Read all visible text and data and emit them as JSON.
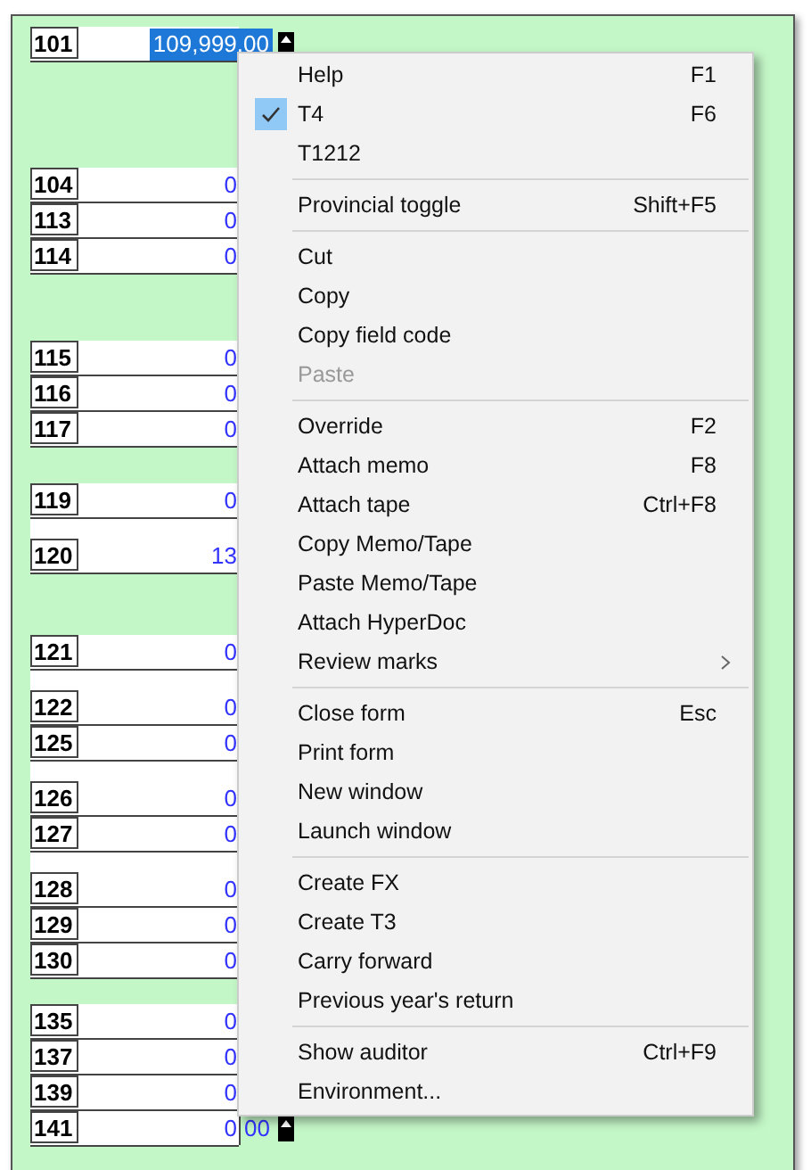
{
  "form": {
    "sections": [
      {
        "rows": [
          {
            "kind": "field",
            "code": "101",
            "value": "109,999.00",
            "selected": true,
            "tall": false
          }
        ]
      },
      {
        "rows": [
          {
            "kind": "field",
            "code": "104",
            "value": "0",
            "selected": false,
            "tall": false
          },
          {
            "kind": "field",
            "code": "113",
            "value": "0",
            "selected": false,
            "tall": false
          },
          {
            "kind": "field",
            "code": "114",
            "value": "0",
            "selected": false,
            "tall": false
          }
        ]
      },
      {
        "rows": [
          {
            "kind": "field",
            "code": "115",
            "value": "0",
            "selected": false,
            "tall": false
          },
          {
            "kind": "field",
            "code": "116",
            "value": "0",
            "selected": false,
            "tall": false
          },
          {
            "kind": "field",
            "code": "117",
            "value": "0",
            "selected": false,
            "tall": false
          }
        ]
      },
      {
        "rows": [
          {
            "kind": "field",
            "code": "119",
            "value": "0",
            "selected": false,
            "tall": false
          },
          {
            "kind": "field",
            "code": "120",
            "value": "13",
            "selected": false,
            "tall": true
          }
        ]
      },
      {
        "rows": [
          {
            "kind": "field",
            "code": "121",
            "value": "0",
            "selected": false,
            "tall": false
          },
          {
            "kind": "field",
            "code": "122",
            "value": "0",
            "selected": false,
            "tall": true
          },
          {
            "kind": "field",
            "code": "125",
            "value": "0",
            "selected": false,
            "tall": false
          },
          {
            "kind": "field",
            "code": "126",
            "value": "0",
            "selected": false,
            "tall": true
          },
          {
            "kind": "field",
            "code": "127",
            "value": "0",
            "selected": false,
            "tall": false
          },
          {
            "kind": "field",
            "code": "128",
            "value": "0",
            "selected": false,
            "tall": true
          },
          {
            "kind": "field",
            "code": "129",
            "value": "0",
            "selected": false,
            "tall": false
          },
          {
            "kind": "field",
            "code": "130",
            "value": "0",
            "selected": false,
            "tall": false
          }
        ]
      },
      {
        "rows": [
          {
            "kind": "field",
            "code": "135",
            "value": "0",
            "selected": false,
            "tall": false
          },
          {
            "kind": "field",
            "code": "137",
            "value": "0",
            "selected": false,
            "tall": false
          },
          {
            "kind": "field",
            "code": "139",
            "value": "0",
            "selected": false,
            "tall": false
          },
          {
            "kind": "split",
            "code": "141",
            "value": "0",
            "cents": "00",
            "selected": false,
            "tall": false
          }
        ]
      }
    ]
  },
  "context_menu": {
    "groups": [
      {
        "items": [
          {
            "label": "Help",
            "shortcut": "F1",
            "checked": false,
            "disabled": false,
            "submenu": false
          },
          {
            "label": "T4",
            "shortcut": "F6",
            "checked": true,
            "disabled": false,
            "submenu": false
          },
          {
            "label": "T1212",
            "checked": false,
            "disabled": false,
            "submenu": false
          }
        ]
      },
      {
        "items": [
          {
            "label": "Provincial toggle",
            "shortcut": "Shift+F5",
            "checked": false,
            "disabled": false,
            "submenu": false
          }
        ]
      },
      {
        "items": [
          {
            "label": "Cut",
            "checked": false,
            "disabled": false,
            "submenu": false
          },
          {
            "label": "Copy",
            "checked": false,
            "disabled": false,
            "submenu": false
          },
          {
            "label": "Copy field code",
            "checked": false,
            "disabled": false,
            "submenu": false
          },
          {
            "label": "Paste",
            "checked": false,
            "disabled": true,
            "submenu": false
          }
        ]
      },
      {
        "items": [
          {
            "label": "Override",
            "shortcut": "F2",
            "checked": false,
            "disabled": false,
            "submenu": false
          },
          {
            "label": "Attach memo",
            "shortcut": "F8",
            "checked": false,
            "disabled": false,
            "submenu": false
          },
          {
            "label": "Attach tape",
            "shortcut": "Ctrl+F8",
            "checked": false,
            "disabled": false,
            "submenu": false
          },
          {
            "label": "Copy Memo/Tape",
            "checked": false,
            "disabled": false,
            "submenu": false
          },
          {
            "label": "Paste Memo/Tape",
            "checked": false,
            "disabled": false,
            "submenu": false
          },
          {
            "label": "Attach HyperDoc",
            "checked": false,
            "disabled": false,
            "submenu": false
          },
          {
            "label": "Review marks",
            "checked": false,
            "disabled": false,
            "submenu": true
          }
        ]
      },
      {
        "items": [
          {
            "label": "Close form",
            "shortcut": "Esc",
            "checked": false,
            "disabled": false,
            "submenu": false
          },
          {
            "label": "Print form",
            "checked": false,
            "disabled": false,
            "submenu": false
          },
          {
            "label": "New window",
            "checked": false,
            "disabled": false,
            "submenu": false
          },
          {
            "label": "Launch window",
            "checked": false,
            "disabled": false,
            "submenu": false
          }
        ]
      },
      {
        "items": [
          {
            "label": "Create FX",
            "checked": false,
            "disabled": false,
            "submenu": false
          },
          {
            "label": "Create T3",
            "checked": false,
            "disabled": false,
            "submenu": false
          },
          {
            "label": "Carry forward",
            "checked": false,
            "disabled": false,
            "submenu": false
          },
          {
            "label": "Previous year's return",
            "checked": false,
            "disabled": false,
            "submenu": false
          }
        ]
      },
      {
        "items": [
          {
            "label": "Show auditor",
            "shortcut": "Ctrl+F9",
            "checked": false,
            "disabled": false,
            "submenu": false
          },
          {
            "label": "Environment...",
            "checked": false,
            "disabled": false,
            "submenu": false
          }
        ]
      }
    ]
  }
}
